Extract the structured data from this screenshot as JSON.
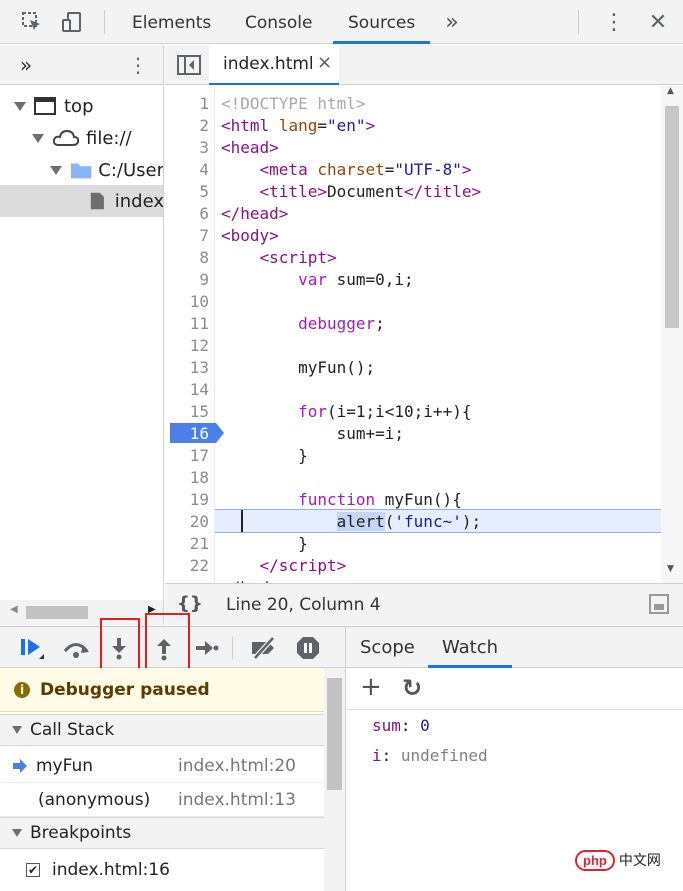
{
  "toolbar": {
    "tabs": [
      "Elements",
      "Console",
      "Sources"
    ],
    "active_tab": "Sources",
    "more_tabs_icon": "»",
    "menu_icon": "⋮",
    "close_icon": "✕",
    "accent_color": "#1a73e8"
  },
  "navigator": {
    "more_icon": "»",
    "menu_icon": "⋮",
    "tree": [
      {
        "label": "top",
        "icon": "frame-icon"
      },
      {
        "label": "file://",
        "icon": "cloud-icon"
      },
      {
        "label": "C:/User",
        "icon": "folder-icon"
      },
      {
        "label": "index",
        "icon": "file-icon",
        "selected": true
      }
    ]
  },
  "editor": {
    "tab_label": "index.html",
    "tab_close": "×",
    "line_numbers": [
      "1",
      "2",
      "3",
      "4",
      "5",
      "6",
      "7",
      "8",
      "9",
      "10",
      "11",
      "12",
      "13",
      "14",
      "15",
      "16",
      "17",
      "18",
      "19",
      "20",
      "21",
      "22"
    ],
    "breakpoint_line": "16",
    "execution_line": "20",
    "status": "Line 20, Column 4",
    "format_icon": "{}"
  },
  "debugger": {
    "paused_label": "Debugger paused",
    "callstack_header": "Call Stack",
    "frames": [
      {
        "name": "myFun",
        "location": "index.html:20",
        "current": true
      },
      {
        "name": "(anonymous)",
        "location": "index.html:13"
      }
    ],
    "breakpoints_header": "Breakpoints",
    "breakpoints": [
      {
        "label": "index.html:16",
        "checked": true
      }
    ]
  },
  "right_panel": {
    "tabs": [
      "Scope",
      "Watch"
    ],
    "active_tab": "Watch",
    "add_icon": "+",
    "refresh_icon": "↻",
    "watches": [
      {
        "name": "sum",
        "value": "0"
      },
      {
        "name": "i",
        "value": "undefined"
      }
    ]
  },
  "watermark": {
    "badge": "php",
    "text": "中文网"
  }
}
